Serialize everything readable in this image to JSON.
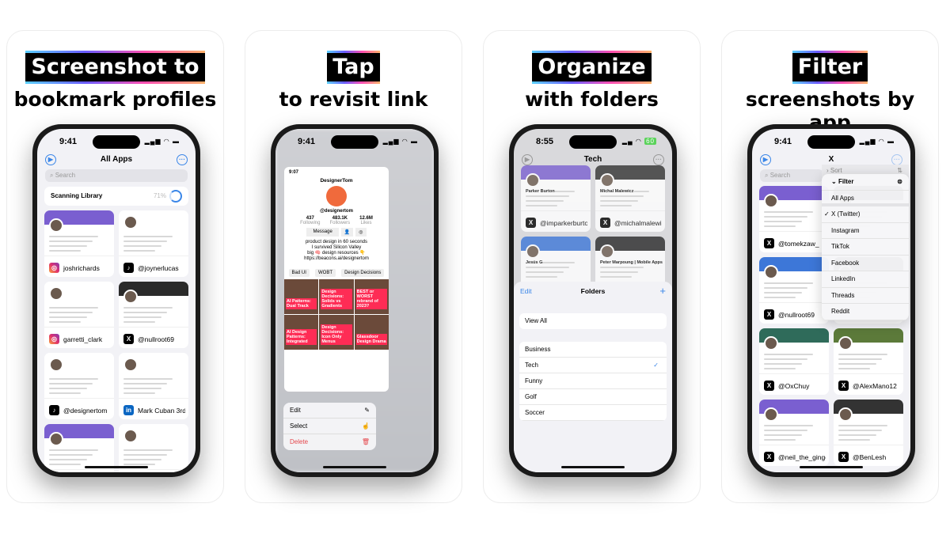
{
  "colors": {
    "accent": "#3a86e8",
    "delete": "#e5484d",
    "tiktok_red": "#fe2c55"
  },
  "panels": [
    {
      "headline": "Screenshot to",
      "subline": "bookmark profiles"
    },
    {
      "headline": "Tap",
      "subline": "to revisit link"
    },
    {
      "headline": "Organize",
      "subline": "with folders"
    },
    {
      "headline": "Filter",
      "subline": "screenshots by app"
    }
  ],
  "phone1": {
    "time": "9:41",
    "title": "All Apps",
    "search_placeholder": "Search",
    "scanning": {
      "label": "Scanning Library",
      "percent": "71%",
      "progress": 0.71
    },
    "cards": [
      {
        "app": "instagram",
        "handle": "joshrichards"
      },
      {
        "app": "tiktok",
        "handle": "@joynerlucas"
      },
      {
        "app": "instagram",
        "handle": "garretti_clark"
      },
      {
        "app": "x",
        "handle": "@nullroot69"
      },
      {
        "app": "tiktok",
        "handle": "@designertom"
      },
      {
        "app": "linkedin",
        "handle": "Mark Cuban 3rd"
      },
      {
        "app": "x",
        "handle": ""
      },
      {
        "app": "instagram",
        "handle": ""
      }
    ]
  },
  "phone2": {
    "time": "9:41",
    "preview": {
      "time": "9:07",
      "name": "DesignerTom",
      "handle": "@designertom",
      "stats": [
        {
          "value": "437",
          "label": "Following"
        },
        {
          "value": "483.1K",
          "label": "Followers"
        },
        {
          "value": "12.6M",
          "label": "Likes"
        }
      ],
      "message_label": "Message",
      "bio": [
        "product design in 60 seconds",
        "I survived Silicon Valley",
        "big 🧠 design resources 👇"
      ],
      "link": "https://beacons.ai/designertom",
      "playlists": [
        "Bad UI",
        "WOBT",
        "Design Decisions"
      ],
      "videos": [
        "AI Patterns: Dual Track",
        "Design Decisions: Solids vs Gradients",
        "BEST or WORST rebrand of 2023?",
        "AI Design Patterns: Integrated",
        "Design Decisions: Icon Only Menus",
        "Glassdoor Design Drama"
      ]
    },
    "menu": [
      {
        "label": "Edit",
        "icon": "pencil-icon"
      },
      {
        "label": "Select",
        "icon": "hand-pointer-icon"
      },
      {
        "label": "Delete",
        "icon": "trash-icon"
      }
    ]
  },
  "phone3": {
    "time": "8:55",
    "battery": "60",
    "title": "Tech",
    "cards": [
      {
        "app": "x",
        "handle": "@imparkerburton",
        "name": "Parker Burton"
      },
      {
        "app": "x",
        "handle": "@michalmalewicz",
        "name": "Michal Malewicz"
      },
      {
        "app": "x",
        "handle": "",
        "name": "Jesús G"
      },
      {
        "app": "x",
        "handle": "",
        "name": "Peter Marpoung | Mobile Apps"
      }
    ],
    "sheet": {
      "edit": "Edit",
      "title": "Folders",
      "add": "+",
      "view_all": "View All",
      "folders": [
        {
          "name": "Business",
          "selected": false
        },
        {
          "name": "Tech",
          "selected": true
        },
        {
          "name": "Funny",
          "selected": false
        },
        {
          "name": "Golf",
          "selected": false
        },
        {
          "name": "Soccer",
          "selected": false
        }
      ]
    }
  },
  "phone4": {
    "time": "9:41",
    "title": "X",
    "search_placeholder": "Search",
    "sort_label": "Sort",
    "filter_label": "Filter",
    "filter_options": [
      {
        "label": "All Apps",
        "checked": false
      },
      {
        "label": "X (Twitter)",
        "checked": true
      },
      {
        "label": "Instagram",
        "checked": false
      },
      {
        "label": "TikTok",
        "checked": false
      },
      {
        "label": "Facebook",
        "checked": false
      },
      {
        "label": "LinkedIn",
        "checked": false
      },
      {
        "label": "Threads",
        "checked": false
      },
      {
        "label": "Reddit",
        "checked": false
      }
    ],
    "cards": [
      {
        "app": "x",
        "handle": "@tomekzaw_"
      },
      {
        "app": "x",
        "handle": ""
      },
      {
        "app": "x",
        "handle": "@nullroot69"
      },
      {
        "app": "x",
        "handle": ""
      },
      {
        "app": "x",
        "handle": "@OxChuy"
      },
      {
        "app": "x",
        "handle": "@AlexMano12"
      },
      {
        "app": "x",
        "handle": "@neil_the_ginger"
      },
      {
        "app": "x",
        "handle": "@BenLesh"
      }
    ]
  }
}
